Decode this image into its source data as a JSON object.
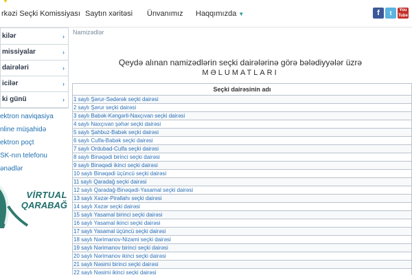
{
  "header": {
    "site_title": "rkəzi Seçki Komissiyası",
    "nav": [
      {
        "label": "Saytın xəritəsi"
      },
      {
        "label": "Ünvanımız"
      },
      {
        "label": "Haqqımızda"
      }
    ],
    "nav_caret": "▼",
    "social": [
      {
        "name": "facebook-icon",
        "glyph": "f"
      },
      {
        "name": "twitter-icon",
        "glyph": "t"
      },
      {
        "name": "youtube-icon",
        "glyph": "You\nTube"
      }
    ]
  },
  "sidebar": {
    "menu": [
      {
        "label": "kilər"
      },
      {
        "label": "missiyalar"
      },
      {
        "label": "dairələri"
      },
      {
        "label": "icilər"
      },
      {
        "label": "ki günü"
      }
    ],
    "chevron": "›",
    "links": [
      {
        "label": "ektron naviqasiya"
      },
      {
        "label": "nline müşahidə"
      },
      {
        "label": "ektron poçt"
      },
      {
        "label": "SK-nın telefonu"
      },
      {
        "label": "ənədlər"
      }
    ],
    "banner": {
      "line1": "VİRTUAL",
      "line2": "QARABAĞ"
    }
  },
  "main": {
    "breadcrumb": "Namizədlər",
    "heading": "Qeydə alınan namizədlərin seçki dairələrinə görə bələdiyyələr üzrə",
    "subheading": "MƏLUMATLARI",
    "table": {
      "header": "Seçki dairəsinin adı",
      "rows": [
        "1 saylı Şərur-Sədərək seçki dairəsi",
        "2 saylı Şərur seçki dairəsi",
        "3 saylı Babək-Kəngərli-Naxçıvan seçki dairəsi",
        "4 saylı Naxçıvan şəhər seçki dairəsi",
        "5 saylı Şahbuz-Babək seçki dairəsi",
        "6 saylı Culfa-Babək seçki dairəsi",
        "7 saylı Ordubad-Culfa seçki dairəsi",
        "8 saylı Binəqədi birinci seçki dairəsi",
        "9 saylı Binəqədi ikinci seçki dairəsi",
        "10 saylı Binəqədi üçüncü seçki dairəsi",
        "11 saylı Qaradağ seçki dairəsi",
        "12 saylı Qaradağ-Binəqədi-Yasamal seçki dairəsi",
        "13 saylı Xəzər-Pirallahı seçki dairəsi",
        "14 saylı Xəzər seçki dairəsi",
        "15 saylı Yasamal birinci seçki dairəsi",
        "16 saylı Yasamal ikinci seçki dairəsi",
        "17 saylı Yasamal üçüncü seçki dairəsi",
        "18 saylı Nərimanov-Nizami seçki dairəsi",
        "19 saylı Nərimanov birinci seçki dairəsi",
        "20 saylı Nərimanov ikinci seçki dairəsi",
        "21 saylı Nəsimi birinci seçki dairəsi",
        "22 saylı Nəsimi ikinci seçki dairəsi"
      ]
    }
  },
  "colors": {
    "accent": "#2a9a8c",
    "link": "#2a6fb5",
    "border": "#b8c2cc"
  }
}
